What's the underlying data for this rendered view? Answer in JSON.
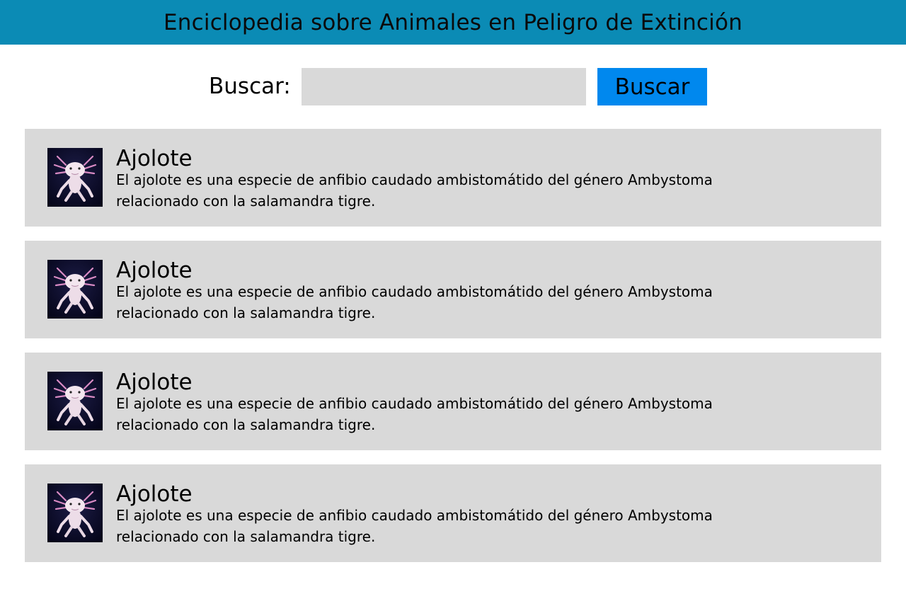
{
  "header": {
    "title": "Enciclopedia sobre Animales en Peligro de Extinción"
  },
  "search": {
    "label": "Buscar:",
    "value": "",
    "placeholder": "",
    "button_label": "Buscar"
  },
  "colors": {
    "header_bg": "#0b8bb5",
    "button_bg": "#0088ee",
    "card_bg": "#d9d9d9",
    "input_bg": "#d9d9d9"
  },
  "animals": [
    {
      "name": "Ajolote",
      "description": "El ajolote es una especie de anfibio caudado ambistomátido del género Ambystoma relacionado con la salamandra tigre.",
      "image": "axolotl-photo"
    },
    {
      "name": "Ajolote",
      "description": "El ajolote es una especie de anfibio caudado ambistomátido del género Ambystoma relacionado con la salamandra tigre.",
      "image": "axolotl-photo"
    },
    {
      "name": "Ajolote",
      "description": "El ajolote es una especie de anfibio caudado ambistomátido del género Ambystoma relacionado con la salamandra tigre.",
      "image": "axolotl-photo"
    },
    {
      "name": "Ajolote",
      "description": "El ajolote es una especie de anfibio caudado ambistomátido del género Ambystoma relacionado con la salamandra tigre.",
      "image": "axolotl-photo"
    }
  ]
}
